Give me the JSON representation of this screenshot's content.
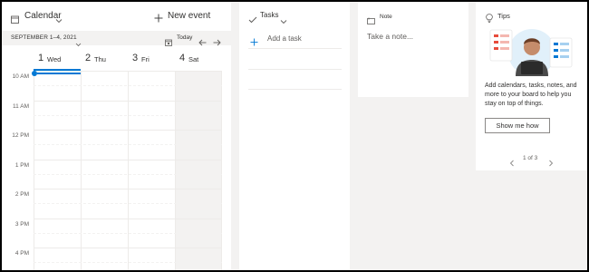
{
  "calendar": {
    "title": "Calendar",
    "new_event_label": "New event",
    "date_range": "SEPTEMBER 1–4, 2021",
    "today_label": "Today",
    "days": [
      {
        "num": "1",
        "name": "Wed",
        "selected": true
      },
      {
        "num": "2",
        "name": "Thu",
        "selected": false
      },
      {
        "num": "3",
        "name": "Fri",
        "selected": false
      },
      {
        "num": "4",
        "name": "Sat",
        "selected": false
      }
    ],
    "times": [
      "10 AM",
      "11 AM",
      "12 PM",
      "1 PM",
      "2 PM",
      "3 PM",
      "4 PM"
    ],
    "icons": {
      "title": "calendar-icon",
      "dropdown": "chevron-down-icon",
      "new_event": "plus-icon",
      "range_dropdown": "chevron-down-icon",
      "today": "calendar-today-icon",
      "prev": "arrow-left-icon",
      "next": "arrow-right-icon"
    }
  },
  "tasks": {
    "title": "Tasks",
    "add_task_label": "Add a task",
    "icons": {
      "title": "checkmark-icon",
      "dropdown": "chevron-down-icon",
      "add": "plus-icon"
    }
  },
  "note": {
    "title": "Note",
    "placeholder": "Take a note...",
    "value": "",
    "icons": {
      "title": "note-icon"
    }
  },
  "tips": {
    "title": "Tips",
    "text": "Add calendars, tasks, notes, and more to your board to help you stay on top of things.",
    "button_label": "Show me how",
    "pager_text": "1 of 3",
    "icons": {
      "title": "lightbulb-icon",
      "prev": "chevron-left-icon",
      "next": "chevron-right-icon"
    }
  },
  "colors": {
    "accent": "#0078d4",
    "background": "#f3f2f1",
    "card": "#ffffff",
    "frame": "#000000"
  }
}
